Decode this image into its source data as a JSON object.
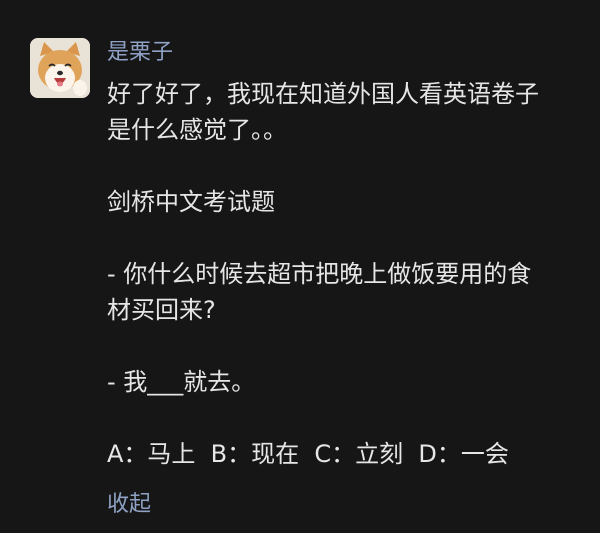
{
  "post": {
    "username": "是栗子",
    "lines": [
      "好了好了，我现在知道外国人看英语卷子",
      "是什么感觉了。。",
      "剑桥中文考试题",
      "- 你什么时候去超市把晚上做饭要用的食",
      "材买回来?",
      "- 我___就去。",
      "A：马上  B：现在  C：立刻  D：一会"
    ],
    "collapse_label": "收起"
  },
  "avatar": {
    "icon": "shiba-dog-avatar"
  },
  "colors": {
    "background": "#161616",
    "text": "#e6e6e6",
    "link": "#8fa2c6"
  }
}
